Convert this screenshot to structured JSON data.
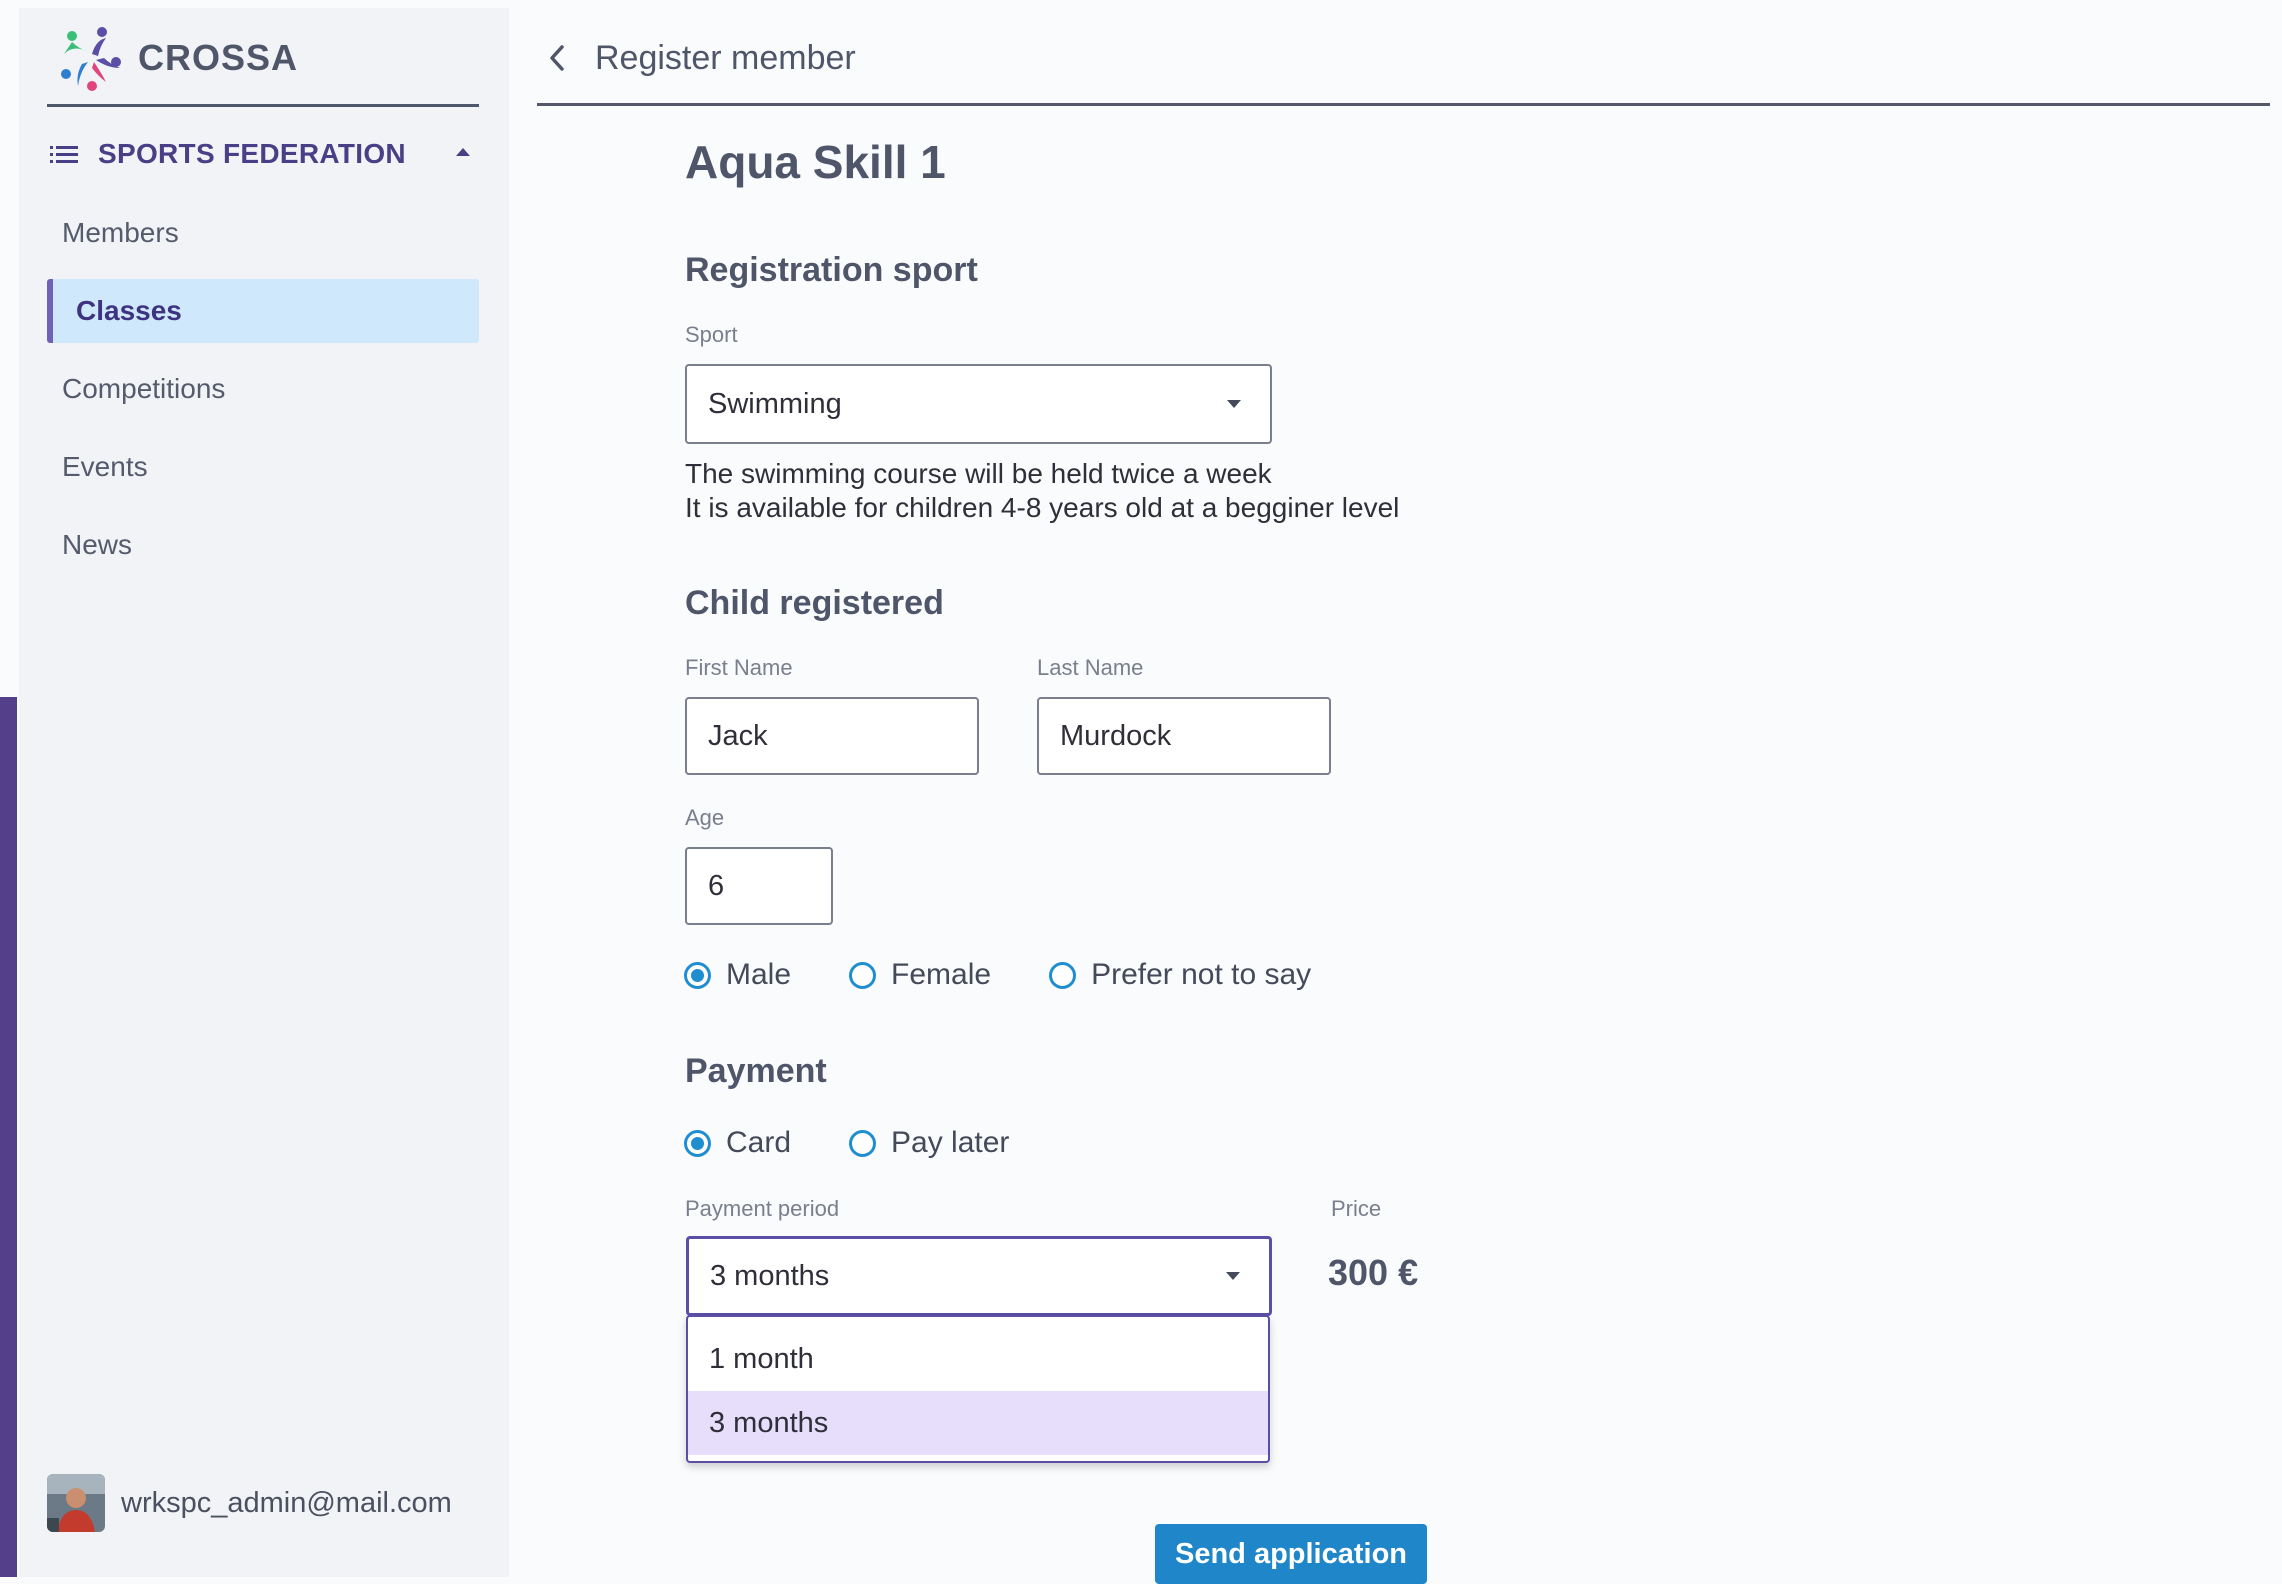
{
  "app": {
    "name": "CROSSA"
  },
  "sidebar": {
    "section_title": "SPORTS FEDERATION",
    "items": [
      {
        "label": "Members"
      },
      {
        "label": "Classes"
      },
      {
        "label": "Competitions"
      },
      {
        "label": "Events"
      },
      {
        "label": "News"
      }
    ],
    "active_item": "Classes",
    "user_email": "wrkspc_admin@mail.com"
  },
  "header": {
    "title": "Register member"
  },
  "page": {
    "title": "Aqua Skill 1",
    "registration": {
      "heading": "Registration sport",
      "sport_label": "Sport",
      "sport_value": "Swimming",
      "description_line1": "The swimming course will be held twice a week",
      "description_line2": "It is available for children 4-8 years old at a begginer level"
    },
    "child": {
      "heading": "Child registered",
      "first_name_label": "First Name",
      "first_name_value": "Jack",
      "last_name_label": "Last Name",
      "last_name_value": "Murdock",
      "age_label": "Age",
      "age_value": "6",
      "gender_options": [
        "Male",
        "Female",
        "Prefer not to say"
      ],
      "gender_selected": "Male"
    },
    "payment": {
      "heading": "Payment",
      "method_options": [
        "Card",
        "Pay later"
      ],
      "method_selected": "Card",
      "period_label": "Payment period",
      "period_value": "3 months",
      "period_options": [
        "1 month",
        "3 months"
      ],
      "price_label": "Price",
      "price_value": "300 €"
    },
    "submit_label": "Send application"
  },
  "colors": {
    "accent_purple": "#533f8a",
    "radio_blue": "#1f8ed0",
    "button_blue": "#1f86c9",
    "active_nav_bg": "#cfe8fb",
    "dropdown_selected_bg": "#e6defa"
  },
  "icons": [
    "crossa-logo",
    "list-icon",
    "caret-up-icon",
    "chevron-left-icon",
    "caret-down-icon"
  ]
}
